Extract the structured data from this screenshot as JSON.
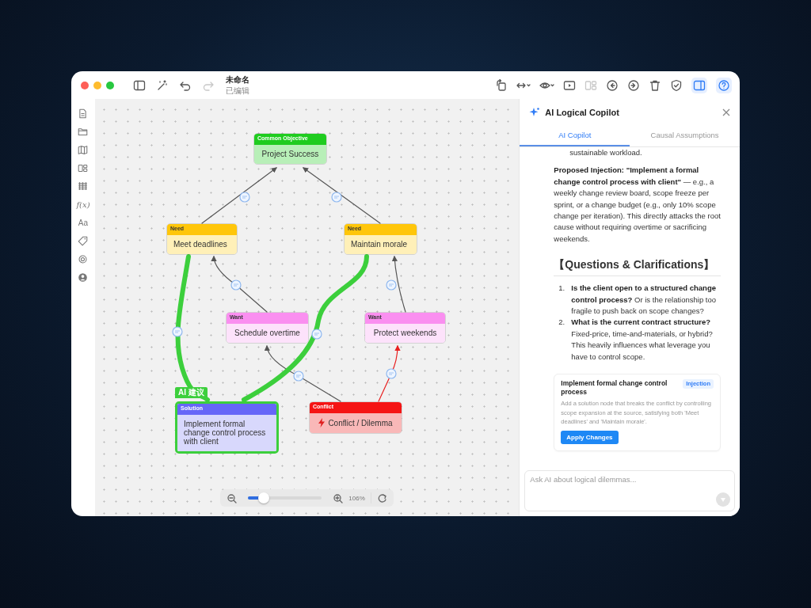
{
  "window": {
    "title": "未命名",
    "subtitle": "已编辑"
  },
  "toolbar_left": [
    {
      "disabled": false
    },
    {
      "disabled": false
    },
    {
      "disabled": false
    },
    {
      "disabled": true
    }
  ],
  "toolbar_right": [
    {
      "disabled": false,
      "active": false
    },
    {
      "disabled": false,
      "active": false
    },
    {
      "disabled": false,
      "active": false
    },
    {
      "disabled": false,
      "active": false
    },
    {
      "disabled": true,
      "active": false
    },
    {
      "disabled": false,
      "active": false
    },
    {
      "disabled": false,
      "active": false
    },
    {
      "disabled": false,
      "active": false
    },
    {
      "disabled": false,
      "active": false
    },
    {
      "disabled": false,
      "active": true
    },
    {
      "disabled": false,
      "active": true
    }
  ],
  "sidebar": {
    "text_items": [
      "f(x)",
      "Aa"
    ]
  },
  "nodes": [
    {
      "kind": "objective",
      "category": "Common Objective",
      "text": "Project Success"
    },
    {
      "kind": "need",
      "category": "Need",
      "text": "Meet deadlines"
    },
    {
      "kind": "need",
      "category": "Need",
      "text": "Maintain morale"
    },
    {
      "kind": "want",
      "category": "Want",
      "text": "Schedule overtime"
    },
    {
      "kind": "want",
      "category": "Want",
      "text": "Protect weekends"
    },
    {
      "kind": "solution",
      "category": "Solution",
      "text": "Implement formal change control process with client",
      "ai_tag": "AI 建议",
      "highlighted": true
    },
    {
      "kind": "conflict",
      "category": "Conflict",
      "text": "Conflict / Dilemma"
    }
  ],
  "edges": [
    {
      "kind": "normal"
    },
    {
      "kind": "normal"
    },
    {
      "kind": "normal"
    },
    {
      "kind": "normal"
    },
    {
      "kind": "normal"
    },
    {
      "kind": "conflict"
    },
    {
      "kind": "suggested"
    },
    {
      "kind": "suggested"
    }
  ],
  "zoom": {
    "level": 0.25,
    "reading": "106%"
  },
  "panel": {
    "title": "AI Logical Copilot",
    "tabs": [
      {
        "label": "AI Copilot",
        "selected": true
      },
      {
        "label": "Causal Assumptions",
        "selected": false
      }
    ],
    "cut_line": "sustainable workload.",
    "paragraph": "**Proposed Injection: \"Implement a formal change control process with client\"** — e.g., a weekly change review board, scope freeze per sprint, or a change budget (e.g., only 10% scope change per iteration). This directly attacks the root cause without requiring overtime or sacrificing weekends.",
    "heading": "【Questions & Clarifications】",
    "questions": [
      {
        "number": "1.",
        "text": "**Is the client open to a structured change control process?** Or is the relationship too fragile to push back on scope changes?"
      },
      {
        "number": "2.",
        "text": "**What is the current contract structure?** Fixed-price, time-and-materials, or hybrid? This heavily influences what leverage you have to control scope."
      }
    ],
    "card": {
      "title": "Implement formal change control process",
      "badge": "Injection",
      "description": "Add a solution node that breaks the conflict by controlling scope expansion at the source, satisfying both 'Meet deadlines' and 'Maintain morale'.",
      "button": "Apply Changes"
    },
    "input": {
      "placeholder": "Ask AI about logical dilemmas...",
      "send_disabled": true
    }
  }
}
